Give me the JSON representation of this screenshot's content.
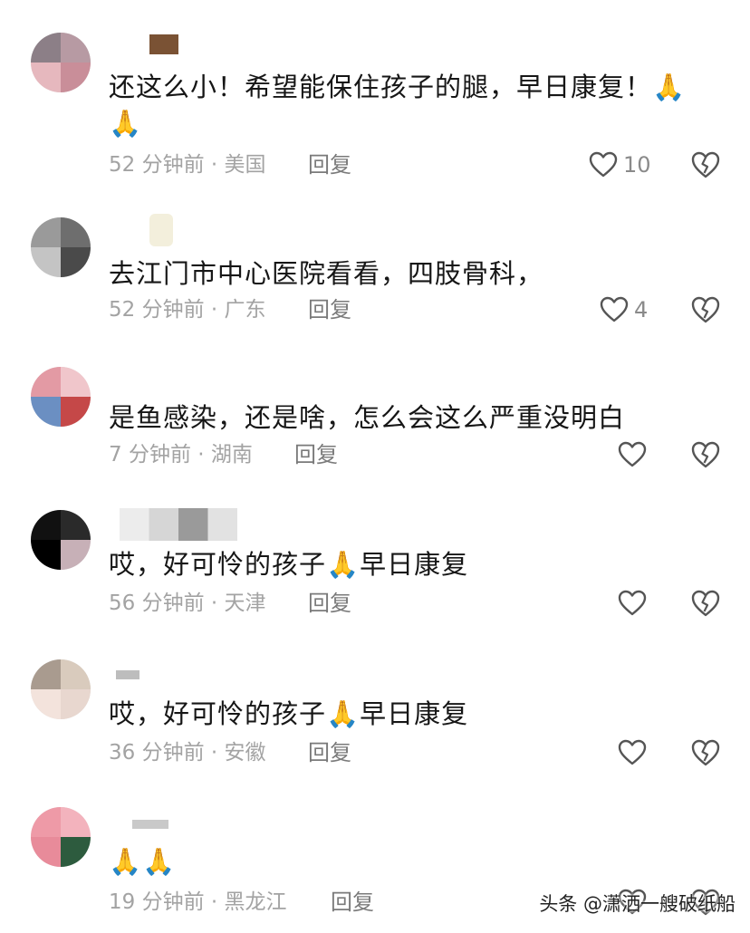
{
  "comments": [
    {
      "text_lines": [
        "还这么小！希望能保住孩子的腿，早日康复！🙏",
        "🙏"
      ],
      "time": "52 分钟前",
      "location": "美国",
      "reply_label": "回复",
      "likes": "10"
    },
    {
      "text_lines": [
        "去江门市中心医院看看，四肢骨科，"
      ],
      "time": "52 分钟前",
      "location": "广东",
      "reply_label": "回复",
      "likes": "4"
    },
    {
      "text_lines": [
        "是鱼感染，还是啥，怎么会这么严重没明白"
      ],
      "time": "7 分钟前",
      "location": "湖南",
      "reply_label": "回复",
      "likes": ""
    },
    {
      "text_lines": [
        "哎，好可怜的孩子🙏早日康复"
      ],
      "time": "56 分钟前",
      "location": "天津",
      "reply_label": "回复",
      "likes": ""
    },
    {
      "text_lines": [
        "哎，好可怜的孩子🙏早日康复"
      ],
      "time": "36 分钟前",
      "location": "安徽",
      "reply_label": "回复",
      "likes": ""
    },
    {
      "text_lines": [
        "🙏🙏"
      ],
      "time": "19 分钟前",
      "location": "黑龙江",
      "reply_label": "回复",
      "likes": ""
    }
  ],
  "meta_separator": " · ",
  "watermark": "头条 @潇洒一艘破纸船",
  "icons": {
    "like": "heart-outline-icon",
    "dislike": "broken-heart-icon",
    "emoji": "praying-hands-emoji"
  },
  "colors": {
    "text": "#161616",
    "meta": "#a3a3a3",
    "reply": "#7a7a7a",
    "emoji": "#f4b400"
  }
}
